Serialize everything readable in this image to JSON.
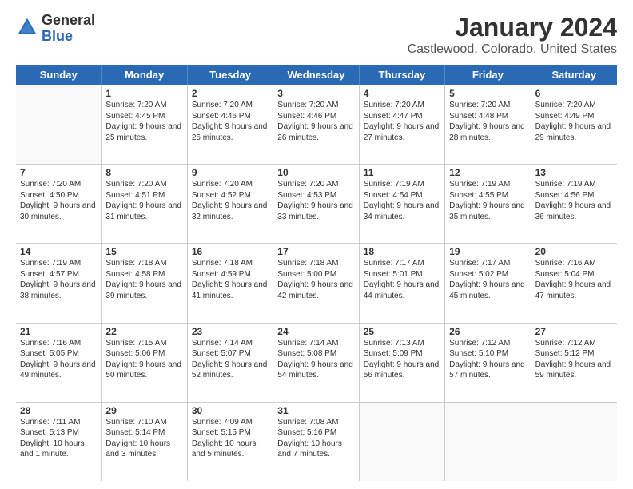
{
  "logo": {
    "line1": "General",
    "line2": "Blue"
  },
  "title": "January 2024",
  "subtitle": "Castlewood, Colorado, United States",
  "days_header": [
    "Sunday",
    "Monday",
    "Tuesday",
    "Wednesday",
    "Thursday",
    "Friday",
    "Saturday"
  ],
  "weeks": [
    [
      {
        "day": "",
        "sunrise": "",
        "sunset": "",
        "daylight": ""
      },
      {
        "day": "1",
        "sunrise": "Sunrise: 7:20 AM",
        "sunset": "Sunset: 4:45 PM",
        "daylight": "Daylight: 9 hours and 25 minutes."
      },
      {
        "day": "2",
        "sunrise": "Sunrise: 7:20 AM",
        "sunset": "Sunset: 4:46 PM",
        "daylight": "Daylight: 9 hours and 25 minutes."
      },
      {
        "day": "3",
        "sunrise": "Sunrise: 7:20 AM",
        "sunset": "Sunset: 4:46 PM",
        "daylight": "Daylight: 9 hours and 26 minutes."
      },
      {
        "day": "4",
        "sunrise": "Sunrise: 7:20 AM",
        "sunset": "Sunset: 4:47 PM",
        "daylight": "Daylight: 9 hours and 27 minutes."
      },
      {
        "day": "5",
        "sunrise": "Sunrise: 7:20 AM",
        "sunset": "Sunset: 4:48 PM",
        "daylight": "Daylight: 9 hours and 28 minutes."
      },
      {
        "day": "6",
        "sunrise": "Sunrise: 7:20 AM",
        "sunset": "Sunset: 4:49 PM",
        "daylight": "Daylight: 9 hours and 29 minutes."
      }
    ],
    [
      {
        "day": "7",
        "sunrise": "Sunrise: 7:20 AM",
        "sunset": "Sunset: 4:50 PM",
        "daylight": "Daylight: 9 hours and 30 minutes."
      },
      {
        "day": "8",
        "sunrise": "Sunrise: 7:20 AM",
        "sunset": "Sunset: 4:51 PM",
        "daylight": "Daylight: 9 hours and 31 minutes."
      },
      {
        "day": "9",
        "sunrise": "Sunrise: 7:20 AM",
        "sunset": "Sunset: 4:52 PM",
        "daylight": "Daylight: 9 hours and 32 minutes."
      },
      {
        "day": "10",
        "sunrise": "Sunrise: 7:20 AM",
        "sunset": "Sunset: 4:53 PM",
        "daylight": "Daylight: 9 hours and 33 minutes."
      },
      {
        "day": "11",
        "sunrise": "Sunrise: 7:19 AM",
        "sunset": "Sunset: 4:54 PM",
        "daylight": "Daylight: 9 hours and 34 minutes."
      },
      {
        "day": "12",
        "sunrise": "Sunrise: 7:19 AM",
        "sunset": "Sunset: 4:55 PM",
        "daylight": "Daylight: 9 hours and 35 minutes."
      },
      {
        "day": "13",
        "sunrise": "Sunrise: 7:19 AM",
        "sunset": "Sunset: 4:56 PM",
        "daylight": "Daylight: 9 hours and 36 minutes."
      }
    ],
    [
      {
        "day": "14",
        "sunrise": "Sunrise: 7:19 AM",
        "sunset": "Sunset: 4:57 PM",
        "daylight": "Daylight: 9 hours and 38 minutes."
      },
      {
        "day": "15",
        "sunrise": "Sunrise: 7:18 AM",
        "sunset": "Sunset: 4:58 PM",
        "daylight": "Daylight: 9 hours and 39 minutes."
      },
      {
        "day": "16",
        "sunrise": "Sunrise: 7:18 AM",
        "sunset": "Sunset: 4:59 PM",
        "daylight": "Daylight: 9 hours and 41 minutes."
      },
      {
        "day": "17",
        "sunrise": "Sunrise: 7:18 AM",
        "sunset": "Sunset: 5:00 PM",
        "daylight": "Daylight: 9 hours and 42 minutes."
      },
      {
        "day": "18",
        "sunrise": "Sunrise: 7:17 AM",
        "sunset": "Sunset: 5:01 PM",
        "daylight": "Daylight: 9 hours and 44 minutes."
      },
      {
        "day": "19",
        "sunrise": "Sunrise: 7:17 AM",
        "sunset": "Sunset: 5:02 PM",
        "daylight": "Daylight: 9 hours and 45 minutes."
      },
      {
        "day": "20",
        "sunrise": "Sunrise: 7:16 AM",
        "sunset": "Sunset: 5:04 PM",
        "daylight": "Daylight: 9 hours and 47 minutes."
      }
    ],
    [
      {
        "day": "21",
        "sunrise": "Sunrise: 7:16 AM",
        "sunset": "Sunset: 5:05 PM",
        "daylight": "Daylight: 9 hours and 49 minutes."
      },
      {
        "day": "22",
        "sunrise": "Sunrise: 7:15 AM",
        "sunset": "Sunset: 5:06 PM",
        "daylight": "Daylight: 9 hours and 50 minutes."
      },
      {
        "day": "23",
        "sunrise": "Sunrise: 7:14 AM",
        "sunset": "Sunset: 5:07 PM",
        "daylight": "Daylight: 9 hours and 52 minutes."
      },
      {
        "day": "24",
        "sunrise": "Sunrise: 7:14 AM",
        "sunset": "Sunset: 5:08 PM",
        "daylight": "Daylight: 9 hours and 54 minutes."
      },
      {
        "day": "25",
        "sunrise": "Sunrise: 7:13 AM",
        "sunset": "Sunset: 5:09 PM",
        "daylight": "Daylight: 9 hours and 56 minutes."
      },
      {
        "day": "26",
        "sunrise": "Sunrise: 7:12 AM",
        "sunset": "Sunset: 5:10 PM",
        "daylight": "Daylight: 9 hours and 57 minutes."
      },
      {
        "day": "27",
        "sunrise": "Sunrise: 7:12 AM",
        "sunset": "Sunset: 5:12 PM",
        "daylight": "Daylight: 9 hours and 59 minutes."
      }
    ],
    [
      {
        "day": "28",
        "sunrise": "Sunrise: 7:11 AM",
        "sunset": "Sunset: 5:13 PM",
        "daylight": "Daylight: 10 hours and 1 minute."
      },
      {
        "day": "29",
        "sunrise": "Sunrise: 7:10 AM",
        "sunset": "Sunset: 5:14 PM",
        "daylight": "Daylight: 10 hours and 3 minutes."
      },
      {
        "day": "30",
        "sunrise": "Sunrise: 7:09 AM",
        "sunset": "Sunset: 5:15 PM",
        "daylight": "Daylight: 10 hours and 5 minutes."
      },
      {
        "day": "31",
        "sunrise": "Sunrise: 7:08 AM",
        "sunset": "Sunset: 5:16 PM",
        "daylight": "Daylight: 10 hours and 7 minutes."
      },
      {
        "day": "",
        "sunrise": "",
        "sunset": "",
        "daylight": ""
      },
      {
        "day": "",
        "sunrise": "",
        "sunset": "",
        "daylight": ""
      },
      {
        "day": "",
        "sunrise": "",
        "sunset": "",
        "daylight": ""
      }
    ]
  ]
}
